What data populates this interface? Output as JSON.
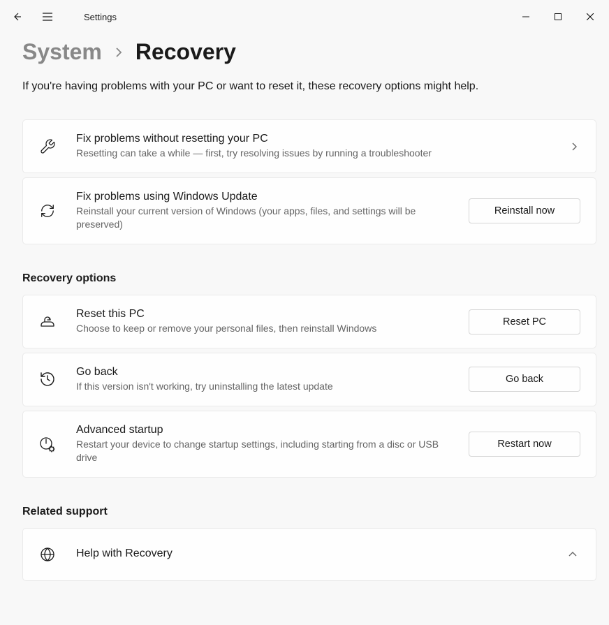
{
  "app_title": "Settings",
  "breadcrumb": {
    "parent": "System",
    "current": "Recovery"
  },
  "intro": "If you're having problems with your PC or want to reset it, these recovery options might help.",
  "fix_section": {
    "items": [
      {
        "title": "Fix problems without resetting your PC",
        "desc": "Resetting can take a while — first, try resolving issues by running a troubleshooter"
      },
      {
        "title": "Fix problems using Windows Update",
        "desc": "Reinstall your current version of Windows (your apps, files, and settings will be preserved)",
        "button": "Reinstall now"
      }
    ]
  },
  "recovery_section": {
    "header": "Recovery options",
    "items": [
      {
        "title": "Reset this PC",
        "desc": "Choose to keep or remove your personal files, then reinstall Windows",
        "button": "Reset PC"
      },
      {
        "title": "Go back",
        "desc": "If this version isn't working, try uninstalling the latest update",
        "button": "Go back"
      },
      {
        "title": "Advanced startup",
        "desc": "Restart your device to change startup settings, including starting from a disc or USB drive",
        "button": "Restart now"
      }
    ]
  },
  "related_section": {
    "header": "Related support",
    "items": [
      {
        "title": "Help with Recovery"
      }
    ]
  }
}
